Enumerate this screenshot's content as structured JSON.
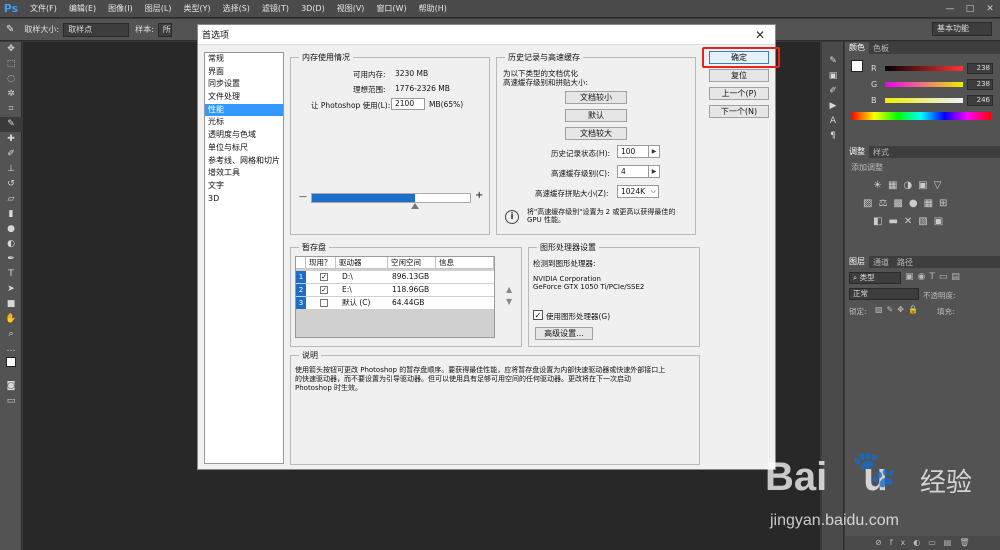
{
  "app": {
    "logo": "Ps",
    "menus": [
      "文件(F)",
      "编辑(E)",
      "图像(I)",
      "图层(L)",
      "类型(Y)",
      "选择(S)",
      "滤镜(T)",
      "3D(D)",
      "视图(V)",
      "窗口(W)",
      "帮助(H)"
    ],
    "window_controls": [
      "—",
      "□",
      "✕"
    ]
  },
  "options_bar": {
    "sample_size_label": "取样大小:",
    "sample_size_value": "取样点",
    "sample_label": "样本:",
    "sample_value": "所",
    "workspace": "基本功能"
  },
  "panels": {
    "color_tabs": [
      "颜色",
      "色板"
    ],
    "color_sliders": [
      {
        "label": "R",
        "value": "238",
        "gradient": "linear-gradient(to right,#000,#ff0000)"
      },
      {
        "label": "G",
        "value": "238",
        "gradient": "linear-gradient(to right,#ee00ee,#eeee00)"
      },
      {
        "label": "B",
        "value": "246",
        "gradient": "linear-gradient(to right,#eeee00,#eeeeff)"
      }
    ],
    "adjust_tabs": [
      "调整",
      "样式"
    ],
    "adjust_title": "添加调整",
    "layer_tabs": [
      "图层",
      "通道",
      "路径"
    ],
    "kind_label": "类型",
    "blend_mode": "正常",
    "opacity_label": "不透明度:",
    "lock_label": "锁定:",
    "fill_label": "填充:"
  },
  "dialog": {
    "title": "首选项",
    "categories": [
      "常规",
      "界面",
      "同步设置",
      "文件处理",
      "性能",
      "光标",
      "透明度与色域",
      "单位与标尺",
      "参考线、网格和切片",
      "增效工具",
      "文字",
      "3D"
    ],
    "selected_category": "性能",
    "memory": {
      "title": "内存使用情况",
      "available_label": "可用内存:",
      "available_value": "3230 MB",
      "ideal_label": "理想范围:",
      "ideal_value": "1776-2326 MB",
      "let_label": "让 Photoshop 使用(L):",
      "let_value": "2100",
      "unit": "MB(65%)",
      "minus": "—",
      "plus": "+"
    },
    "history": {
      "title": "历史记录与高速缓存",
      "desc1": "为以下类型的文档优化",
      "desc2": "高速缓存级别和拼贴大小:",
      "btn_tall": "文档较小",
      "btn_default": "默认",
      "btn_large": "文档较大",
      "history_states_label": "历史记录状态(H):",
      "history_states_value": "100",
      "cache_levels_label": "高速缓存级别(C):",
      "cache_levels_value": "4",
      "tile_size_label": "高速缓存拼贴大小(Z):",
      "tile_size_value": "1024K",
      "info_line1": "将\"高速缓存级别\"设置为 2 或更高以获得最佳的",
      "info_line2": "GPU 性能。"
    },
    "scratch": {
      "title": "暂存盘",
      "headers": [
        "现用？",
        "驱动器",
        "空闲空间",
        "信息"
      ],
      "rows": [
        {
          "num": "1",
          "checked": "✓",
          "drive": "D:\\",
          "free": "896.13GB"
        },
        {
          "num": "2",
          "checked": "✓",
          "drive": "E:\\",
          "free": "118.96GB"
        },
        {
          "num": "3",
          "checked": "",
          "drive": "默认 (C)",
          "free": "64.44GB"
        }
      ],
      "up_arrow": "▲",
      "down_arrow": "▼"
    },
    "gpu": {
      "title": "图形处理器设置",
      "detected_label": "检测到图形处理器:",
      "vendor": "NVIDIA Corporation",
      "model": "GeForce GTX 1050 Ti/PCIe/SSE2",
      "use_gpu_label": "使用图形处理器(G)",
      "use_gpu_checked": "✓",
      "advanced_btn": "高级设置..."
    },
    "description": {
      "title": "说明",
      "line1": "使用箭头按钮可更改 Photoshop 的暂存盘顺序。要获得最佳性能，应将暂存盘设置为内部快速驱动器或快速外部接口上",
      "line2": "的快速驱动器，而不要设置为引导驱动器。但可以使用具有足够可用空间的任何驱动器。更改将在下一次启动",
      "line3": "Photoshop 时生效。"
    },
    "buttons": {
      "ok": "确定",
      "reset": "复位",
      "prev": "上一个(P)",
      "next": "下一个(N)"
    },
    "memory_fraction": 0.65
  },
  "watermark": {
    "logo": "Bai",
    "logo2": "u",
    "cn": "经验",
    "url": "jingyan.baidu.com"
  },
  "colors": {
    "accent": "#1e6ec8",
    "highlight": "#e8221c",
    "selected": "#3399ff"
  }
}
